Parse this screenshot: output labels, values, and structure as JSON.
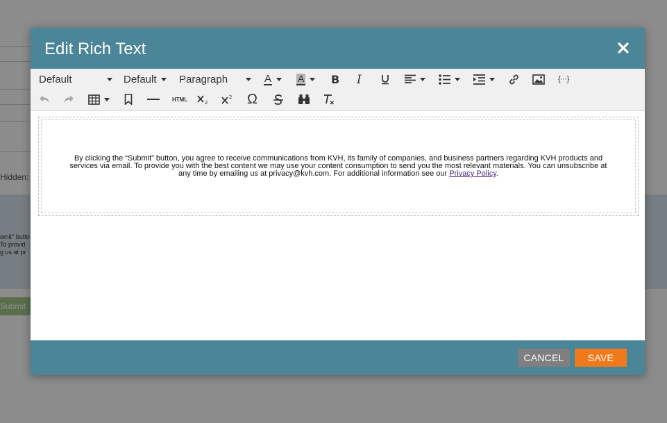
{
  "background": {
    "hidden_label": "Hidden: \"",
    "consent_snippet": [
      "omit\" butto",
      "To provid",
      "g us at pr"
    ],
    "submit_label": "Submit"
  },
  "modal": {
    "title": "Edit Rich Text",
    "close_icon": "close-icon"
  },
  "toolbar": {
    "font_family": "Default",
    "font_size": "Default",
    "block_format": "Paragraph",
    "row1_icons": [
      "text-color-icon",
      "background-color-icon",
      "bold-icon",
      "italic-icon",
      "underline-icon",
      "align-icon",
      "bullet-list-icon",
      "indent-icon",
      "link-icon",
      "image-icon",
      "template-token-icon"
    ],
    "row2_icons": [
      "undo-icon",
      "redo-icon",
      "table-icon",
      "bookmark-icon",
      "horizontal-rule-icon",
      "html-icon",
      "subscript-icon",
      "superscript-icon",
      "special-character-icon",
      "strikethrough-icon",
      "find-replace-icon",
      "clear-formatting-icon"
    ],
    "html_label": "HTML",
    "text_color_letter": "A",
    "bg_color_letter": "A",
    "token_label": "{···}",
    "omega": "Ω"
  },
  "editor": {
    "consent_text": "By clicking the “Submit” button, you agree to receive communications from KVH, its family of companies, and business partners regarding KVH products and services via email. To provide you with the best content we may use your content consumption to send you the most relevant materials. You can unsubscribe at any time by emailing us at privacy@kvh.com. For additional information see our ",
    "privacy_link": "Privacy Policy",
    "trailing": "."
  },
  "footer": {
    "cancel_label": "CANCEL",
    "save_label": "SAVE"
  },
  "colors": {
    "header": "#4b8598",
    "save": "#f07a1b",
    "cancel": "#7f7f7f",
    "link": "#4b2680"
  }
}
